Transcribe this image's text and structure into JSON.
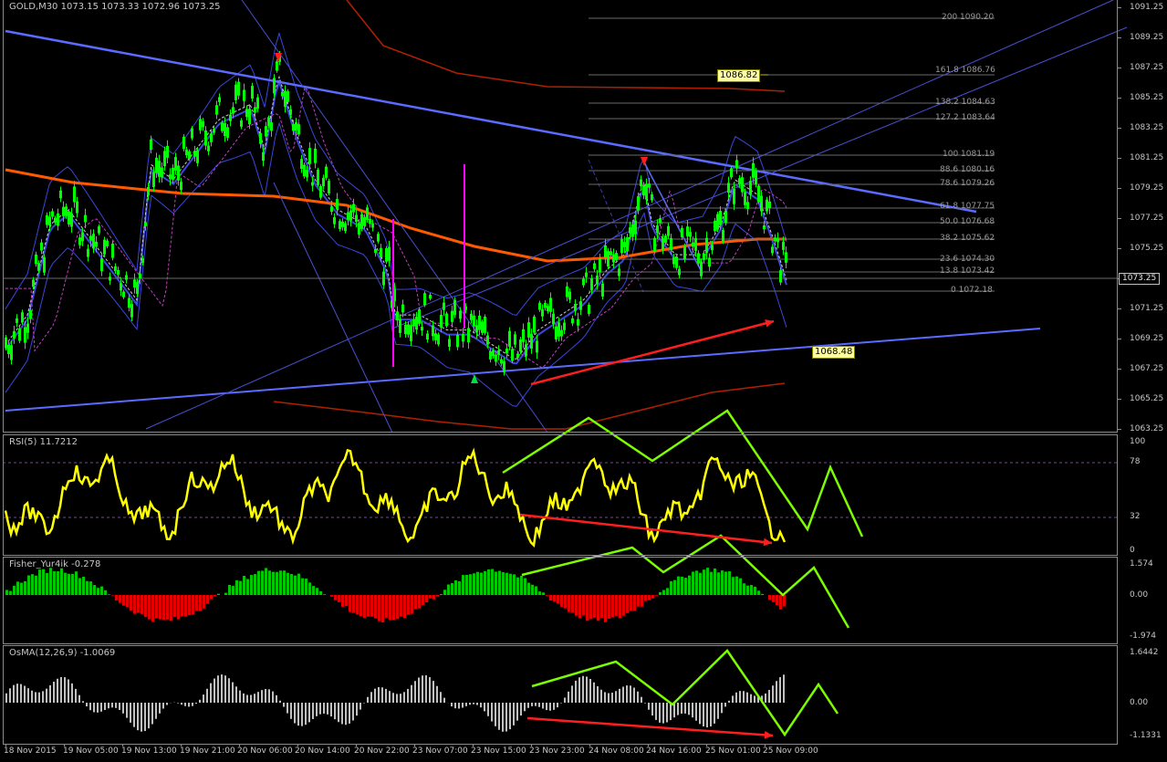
{
  "window": {
    "title": "GOLD,M30 1073.15 1073.33 1072.96 1073.25"
  },
  "price_axis": {
    "labels": [
      "1091.25",
      "1089.25",
      "1087.25",
      "1085.25",
      "1083.25",
      "1081.25",
      "1079.25",
      "1077.25",
      "1075.25",
      "1073.25",
      "1071.25",
      "1069.25",
      "1067.25",
      "1065.25",
      "1063.25"
    ],
    "current_price": "1073.25"
  },
  "fibonacci_levels": [
    {
      "label": "200 1090.20"
    },
    {
      "label": "161.8 1086.76"
    },
    {
      "label": "138.2 1084.63"
    },
    {
      "label": "127.2 1083.64"
    },
    {
      "label": "100 1081.19"
    },
    {
      "label": "88.6 1080.16"
    },
    {
      "label": "78.6 1079.26"
    },
    {
      "label": "61.8 1077.75"
    },
    {
      "label": "50.0 1076.68"
    },
    {
      "label": "38.2 1075.62"
    },
    {
      "label": "23.6 1074.30"
    },
    {
      "label": "13.8 1073.42"
    },
    {
      "label": "0 1072.18"
    }
  ],
  "price_tags": {
    "upper": "1086.82",
    "lower": "1068.48"
  },
  "rsi_panel": {
    "label": "RSI(5) 11.7212",
    "scale": [
      "100",
      "78",
      "32",
      "0"
    ]
  },
  "fisher_panel": {
    "label": "Fisher_Yur4ik -0.278",
    "scale": [
      "1.574",
      "0.00",
      "-1.974"
    ]
  },
  "osma_panel": {
    "label": "OsMA(12,26,9) -1.0069",
    "scale": [
      "1.6442",
      "0.00",
      "-1.1331"
    ]
  },
  "time_axis": {
    "labels": [
      "18 Nov 2015",
      "19 Nov 05:00",
      "19 Nov 13:00",
      "19 Nov 21:00",
      "20 Nov 06:00",
      "20 Nov 14:00",
      "20 Nov 22:00",
      "23 Nov 07:00",
      "23 Nov 15:00",
      "23 Nov 23:00",
      "24 Nov 08:00",
      "24 Nov 16:00",
      "25 Nov 01:00",
      "25 Nov 09:00"
    ]
  },
  "colors": {
    "background": "#000000",
    "candles": "#00ff00",
    "trendline": "#5b6bff",
    "bollinger": "#3c46dc",
    "ma_orange": "#ff5a00",
    "rsi_line": "#ffff00",
    "histogram_up": "#00c800",
    "histogram_down": "#e60000",
    "osma_bars": "#c0c0c0",
    "arrow_red": "#ff1e1e",
    "arrow_green": "#7cfc00",
    "magenta_line": "#ff00ff"
  }
}
